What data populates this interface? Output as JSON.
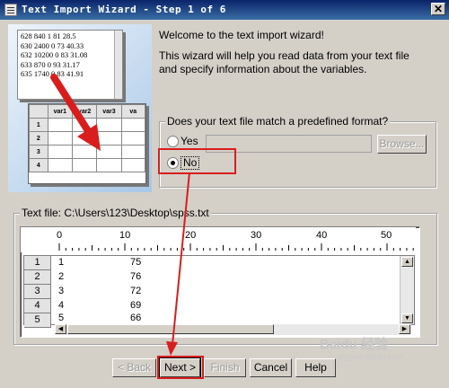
{
  "window": {
    "title": "Text Import Wizard - Step 1 of 6",
    "close_glyph": "✕"
  },
  "illustration": {
    "sample_lines": [
      "628 840 1 81 28.5",
      "630 2400 0 73 40.33",
      "632 10200 0 83 31.08",
      "633 870 0 93 31.17",
      "635 1740 0 83 41.91"
    ],
    "grid_headers": [
      "var1",
      "var2",
      "var3",
      "va"
    ],
    "grid_rows": [
      "1",
      "2",
      "3",
      "4"
    ]
  },
  "intro": {
    "welcome": "Welcome to the text import wizard!",
    "description": "This wizard will help you read data from your text file and specify information about the variables."
  },
  "format_group": {
    "legend": "Does your text file match a predefined format?",
    "yes_label": "Yes",
    "no_label": "No",
    "selected": "No",
    "browse_label": "Browse..."
  },
  "preview": {
    "legend": "Text file:  C:\\Users\\123\\Desktop\\spss.txt",
    "ruler_numbers": [
      "0",
      "10",
      "20",
      "30",
      "40",
      "50"
    ],
    "rows": [
      {
        "num": "1",
        "col1": "1",
        "col2": "75"
      },
      {
        "num": "2",
        "col1": "2",
        "col2": "76"
      },
      {
        "num": "3",
        "col1": "3",
        "col2": "72"
      },
      {
        "num": "4",
        "col1": "4",
        "col2": "69"
      },
      {
        "num": "5",
        "col1": "5",
        "col2": "66"
      }
    ]
  },
  "buttons": {
    "back": "< Back",
    "next": "Next >",
    "finish": "Finish",
    "cancel": "Cancel",
    "help": "Help"
  },
  "watermark": {
    "brand": "Baidu 经验",
    "url": "jingyan.baidu.com"
  },
  "colors": {
    "annotation_red": "#d91d1d",
    "titlebar": "#0a246a",
    "dialog_bg": "#d4d0c8"
  }
}
